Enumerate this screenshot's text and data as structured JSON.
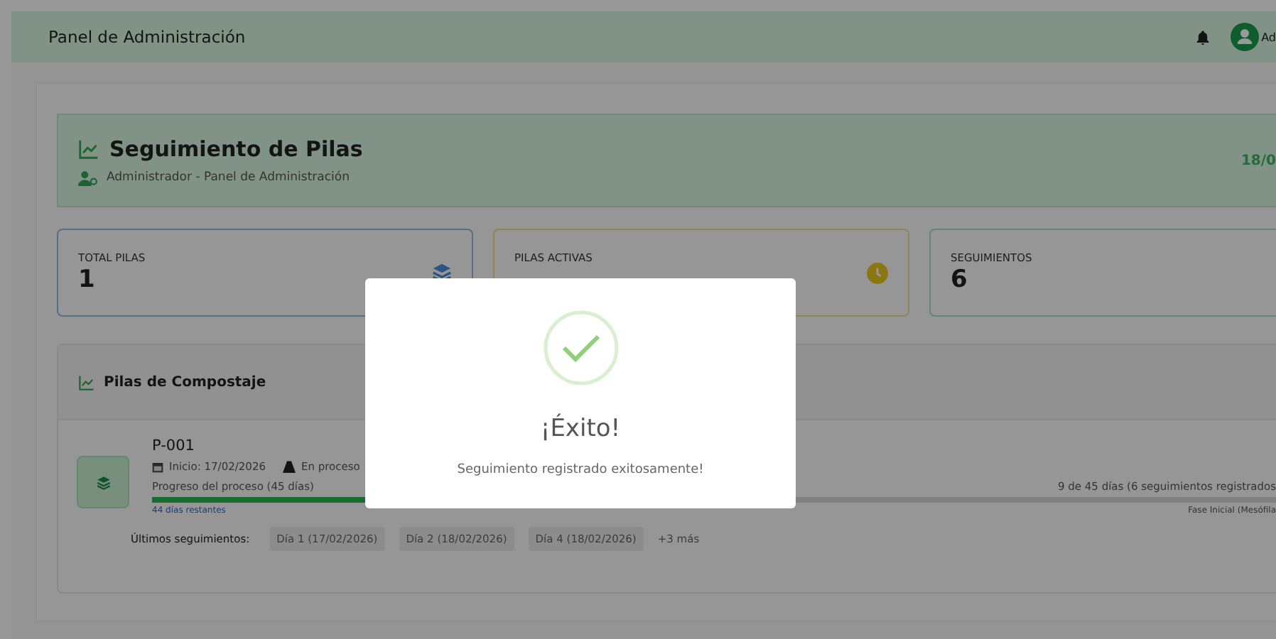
{
  "header": {
    "title": "Panel de Administración",
    "user_name": "Ad"
  },
  "banner": {
    "title": "Seguimiento de Pilas",
    "subtitle": "Administrador - Panel de Administración",
    "date": "18/0"
  },
  "stats": [
    {
      "label": "TOTAL PILAS",
      "value": "1"
    },
    {
      "label": "PILAS ACTIVAS"
    },
    {
      "label": "SEGUIMIENTOS",
      "value": "6"
    }
  ],
  "section": {
    "title": "Pilas de Compostaje"
  },
  "piles": [
    {
      "code": "P-001",
      "start": "Inicio: 17/02/2026",
      "status": "En proceso",
      "progress_label": "Progreso del proceso (45 días)",
      "progress_summary": "9 de 45 días (6 seguimientos registrados",
      "level": 0.2,
      "remaining": "44 días restantes",
      "phase": "Fase Inicial (Mesófila",
      "recent_label": "Últimos seguimientos:",
      "recent": [
        "Día 1 (17/02/2026)",
        "Día 2 (18/02/2026)",
        "Día 4 (18/02/2026)"
      ],
      "more": "+3 más"
    }
  ],
  "modal": {
    "title": "¡Éxito!",
    "message": "Seguimiento registrado exitosamente!"
  }
}
